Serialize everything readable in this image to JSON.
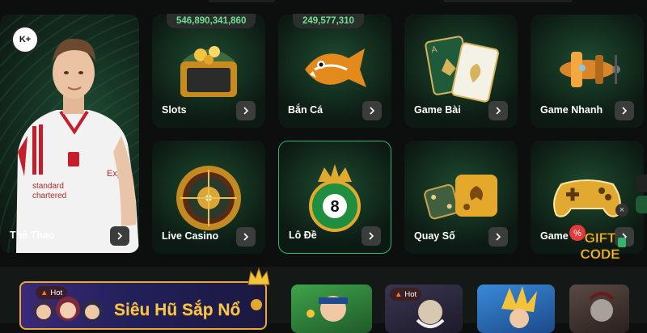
{
  "sports": {
    "label": "Thể Thao",
    "logo_text": "K+"
  },
  "cards": [
    {
      "id": "slots",
      "label": "Slots",
      "jackpot": "546,890,341,860",
      "icon": "treasure-chest-icon"
    },
    {
      "id": "ban-ca",
      "label": "Bắn Cá",
      "jackpot": "249,577,310",
      "icon": "fish-icon"
    },
    {
      "id": "game-bai",
      "label": "Game Bài",
      "icon": "playing-cards-icon"
    },
    {
      "id": "game-nhanh",
      "label": "Game Nhanh",
      "icon": "airplane-icon"
    },
    {
      "id": "live-casino",
      "label": "Live Casino",
      "icon": "roulette-icon"
    },
    {
      "id": "lo-de",
      "label": "Lô Đề",
      "icon": "lottery-ball-icon",
      "ball_number": "8"
    },
    {
      "id": "quay-so",
      "label": "Quay Số",
      "icon": "dice-icon"
    },
    {
      "id": "game-khac",
      "label": "Game K",
      "icon": "gamepad-icon"
    }
  ],
  "promo": {
    "title": "Siêu Hũ Sắp Nổ",
    "hot_label": "Hot"
  },
  "thumbs": [
    {
      "hot_label": "Hot"
    }
  ],
  "gift": {
    "line1": "GIFT",
    "line2": "CODE",
    "close": "×"
  },
  "colors": {
    "accent_green": "#2fb56c",
    "jackpot_green": "#6fe08f",
    "gold": "#f6c650"
  }
}
